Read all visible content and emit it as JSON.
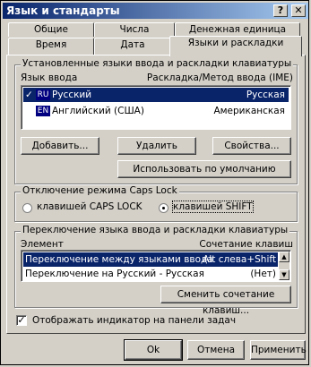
{
  "window": {
    "title": "Язык и стандарты",
    "help": "?",
    "close": "✕"
  },
  "tabs": {
    "row1": [
      "Общие",
      "Числа",
      "Денежная единица"
    ],
    "row2": [
      "Время",
      "Дата",
      "Языки и раскладки"
    ],
    "active": "Языки и раскладки"
  },
  "installed": {
    "group_title": "Установленные языки ввода и раскладки клавиатуры",
    "col_lang": "Язык ввода",
    "col_layout": "Раскладка/Метод ввода (IME)",
    "items": [
      {
        "code": "RU",
        "name": "Русский",
        "layout": "Русская",
        "checked": "✓"
      },
      {
        "code": "EN",
        "name": "Английский (США)",
        "layout": "Американская",
        "checked": ""
      }
    ],
    "add": "Добавить...",
    "remove": "Удалить",
    "properties": "Свойства...",
    "default": "Использовать по умолчанию"
  },
  "capslock": {
    "group_title": "Отключение режима Caps Lock",
    "opt1": "клавишей CAPS LOCK",
    "opt2": "клавишей SHIFT",
    "selected": "opt2"
  },
  "hotkeys": {
    "group_title": "Переключение языка ввода и раскладки клавиатуры",
    "col_item": "Элемент",
    "col_keys": "Сочетание клавиш",
    "items": [
      {
        "name": "Переключение между языками ввода",
        "keys": "Alt слева+Shift"
      },
      {
        "name": "Переключение на Русский - Русская",
        "keys": "(Нет)"
      }
    ],
    "change": "Сменить сочетание клавиш..."
  },
  "indicator": {
    "label": "Отображать индикатор на панели задач",
    "checked": "✓"
  },
  "footer": {
    "ok": "Ok",
    "cancel": "Отмена",
    "apply": "Применить"
  }
}
